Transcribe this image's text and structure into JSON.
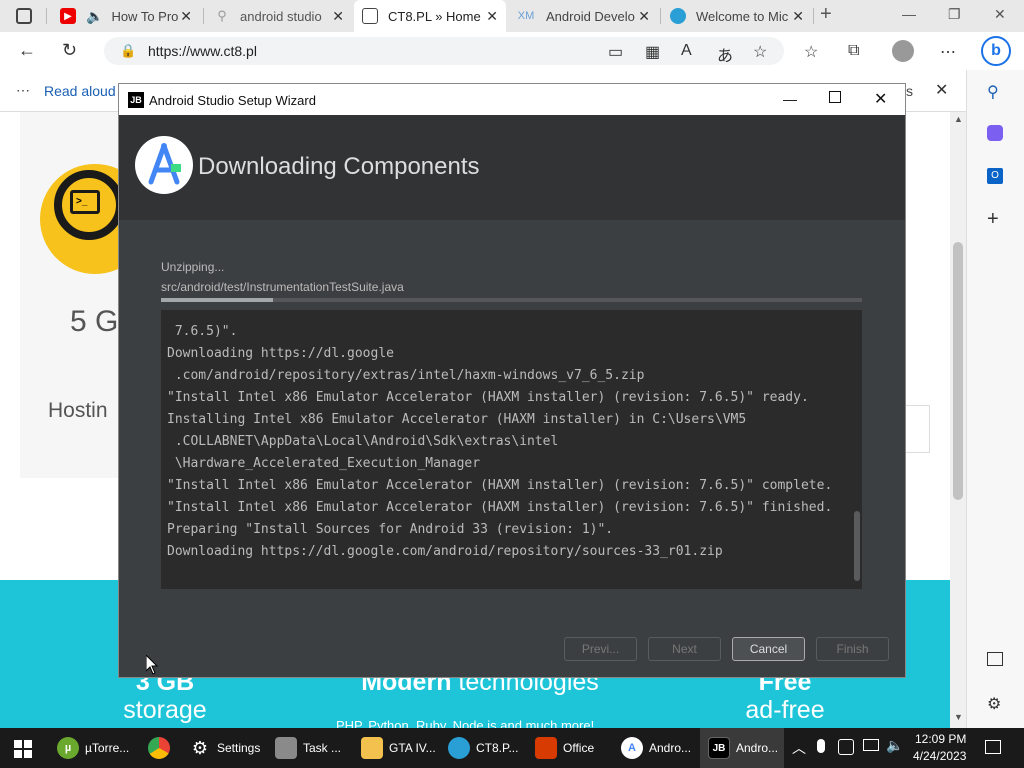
{
  "browser": {
    "tabs": [
      {
        "label": "How To Pro",
        "icon": "youtube-icon"
      },
      {
        "label": "android studio",
        "icon": "search-icon"
      },
      {
        "label": "CT8.PL » Home",
        "icon": "page-icon"
      },
      {
        "label": "Android Develo",
        "icon": "xml-icon"
      },
      {
        "label": "Welcome to Mic",
        "icon": "edge-icon"
      }
    ],
    "url": "https://www.ct8.pl",
    "read_aloud": "Read aloud",
    "read_aloud_trail": "s"
  },
  "webpage": {
    "heading_partial": "5 G",
    "hosting_partial": "Hostin",
    "features": [
      {
        "bold": "3 GB",
        "text": "storage"
      },
      {
        "bold": "Modern",
        "text": " technologies"
      },
      {
        "bold": "Free",
        "text": "ad-free"
      }
    ],
    "tech_line": "PHP, Python, Ruby, Node is and much more!"
  },
  "dialog": {
    "window_title": "Android Studio Setup Wizard",
    "app_badge": "JB",
    "heading": "Downloading Components",
    "status": "Unzipping...",
    "current_file": "src/android/test/InstrumentationTestSuite.java",
    "progress": 0.16,
    "console_lines": [
      " 7.6.5)\".",
      "Downloading https://dl.google",
      " .com/android/repository/extras/intel/haxm-windows_v7_6_5.zip",
      "\"Install Intel x86 Emulator Accelerator (HAXM installer) (revision: 7.6.5)\" ready.",
      "Installing Intel x86 Emulator Accelerator (HAXM installer) in C:\\Users\\VM5",
      " .COLLABNET\\AppData\\Local\\Android\\Sdk\\extras\\intel",
      " \\Hardware_Accelerated_Execution_Manager",
      "\"Install Intel x86 Emulator Accelerator (HAXM installer) (revision: 7.6.5)\" complete.",
      "\"Install Intel x86 Emulator Accelerator (HAXM installer) (revision: 7.6.5)\" finished.",
      "Preparing \"Install Sources for Android 33 (revision: 1)\".",
      "Downloading https://dl.google.com/android/repository/sources-33_r01.zip"
    ],
    "buttons": {
      "prev": "Previ...",
      "next": "Next",
      "cancel": "Cancel",
      "finish": "Finish"
    }
  },
  "taskbar": {
    "items": [
      {
        "label": "µTorre...",
        "icon": "utorrent-icon"
      },
      {
        "label": "",
        "icon": "chrome-icon"
      },
      {
        "label": "Settings",
        "icon": "settings-icon"
      },
      {
        "label": "Task ...",
        "icon": "task-manager-icon"
      },
      {
        "label": "GTA IV...",
        "icon": "folder-icon"
      },
      {
        "label": "CT8.P...",
        "icon": "edge-icon"
      },
      {
        "label": "Office",
        "icon": "office-icon"
      },
      {
        "label": "Andro...",
        "icon": "android-studio-icon"
      },
      {
        "label": "Andro...",
        "icon": "jetbrains-icon"
      }
    ],
    "time": "12:09 PM",
    "date": "4/24/2023"
  },
  "colors": {
    "dialog_bg": "#3c3f41",
    "web_teal": "#1ec5d8",
    "logo_yellow": "#f7c21b",
    "edge_link": "#1a5fb4"
  }
}
